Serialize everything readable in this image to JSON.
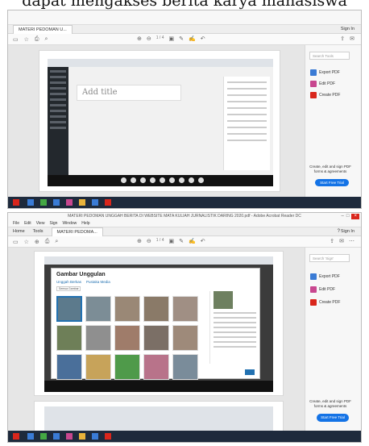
{
  "caption": "dapat mengakses berita karya mahasiswa",
  "shot1": {
    "doc_tab": "MATERI PEDOMAN U..."
  },
  "shot2": {
    "window_title": "MATERI PEDOMAN UNGGAH BERITA DI WEBSITE MATA KULIAH JURNALISTIK DARING 2020.pdf - Adobe Acrobat Reader DC",
    "menu": [
      "File",
      "Edit",
      "View",
      "Sign",
      "Window",
      "Help"
    ],
    "tabs": {
      "home": "Home",
      "tools": "Tools",
      "doc": "MATERI PEDOMA..."
    },
    "sign_in": "Sign In",
    "page_num": "1 / 4",
    "search_tools_placeholder": "Search 'Sign'",
    "tools": [
      "Export PDF",
      "Edit PDF",
      "Create PDF"
    ],
    "promo": "Create, edit and sign PDF forms & agreements",
    "trial_button": "Start Free Trial",
    "modal_title": "Gambar Unggulan",
    "modal_tabs": [
      "Unggah Berkas",
      "Pustaka Media"
    ],
    "modal_filter": "Semua Gambar"
  },
  "shot1_inner": {
    "add_title": "Add title",
    "page_num": "1 / 4",
    "search_tools_placeholder": "Search Tools",
    "tools": [
      "Export PDF",
      "Edit PDF",
      "Create PDF"
    ],
    "promo": "Create, edit and sign PDF forms & agreements",
    "trial_button": "Start Free Trial",
    "sign_in": "Sign In"
  },
  "colors": {
    "acrobat_red": "#d9261c",
    "trial_blue": "#1473e6",
    "wp_dark": "#23282d",
    "taskbar": "#1e2a3c"
  }
}
